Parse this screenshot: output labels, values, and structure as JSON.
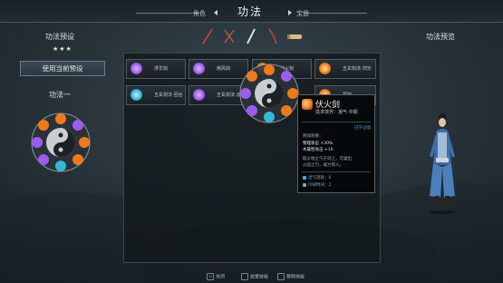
{
  "topbar": {
    "left_tab": "角色",
    "active_tab": "功法",
    "right_tab": "宝盘"
  },
  "left": {
    "preset_title": "功法预设",
    "stars": "★★★",
    "use_preset_button": "使用当前预设",
    "preset_name": "功法一"
  },
  "right": {
    "preview_title": "功法预览"
  },
  "weapon_icons": [
    "spear-icon",
    "twin-swords-icon",
    "sword-icon",
    "blade-icon",
    "scroll-icon"
  ],
  "skills": [
    {
      "name": "浮华剑",
      "color": "#9c5cf0",
      "icon": "swirl-icon"
    },
    {
      "name": "疾风剑",
      "color": "#9c5cf0",
      "icon": "swirl-icon"
    },
    {
      "name": "伏火剑",
      "color": "#ef7a1a",
      "icon": "fire-icon"
    },
    {
      "name": "五玄剑法·归光",
      "color": "#ef7a1a",
      "icon": "fire-icon"
    },
    {
      "name": "五玄剑法·回合",
      "color": "#35b7d6",
      "icon": "swirl-icon"
    },
    {
      "name": "五玄剑法·云",
      "color": "#9c5cf0",
      "icon": "swirl-icon"
    },
    {
      "name": "冥剑",
      "color": "#ef7a1a",
      "icon": "fire-icon"
    }
  ],
  "tooltip": {
    "title": "伏火剑",
    "subtitle": "需求境界：凝气·中期",
    "equipped": "已学过境",
    "effect_head": "附加效果：",
    "effect1": "物理攻击 +30%",
    "effect2": "木属性攻击 +10",
    "desc1": "取火地之气于剑上，可凝出",
    "desc2": "火焰之刃，威力惊人。",
    "cost1": "灵气消耗：6",
    "cost2": "冷却时间：2"
  },
  "hints": [
    {
      "key": "G",
      "label": "关闭"
    },
    {
      "key": "",
      "label": "放置技能"
    },
    {
      "key": "",
      "label": "移除技能"
    }
  ],
  "colors": {
    "fire": "#ef7a1a",
    "purple": "#9c5cf0",
    "cyan": "#35b7d6",
    "accent_blue": "#4fa8e6"
  }
}
